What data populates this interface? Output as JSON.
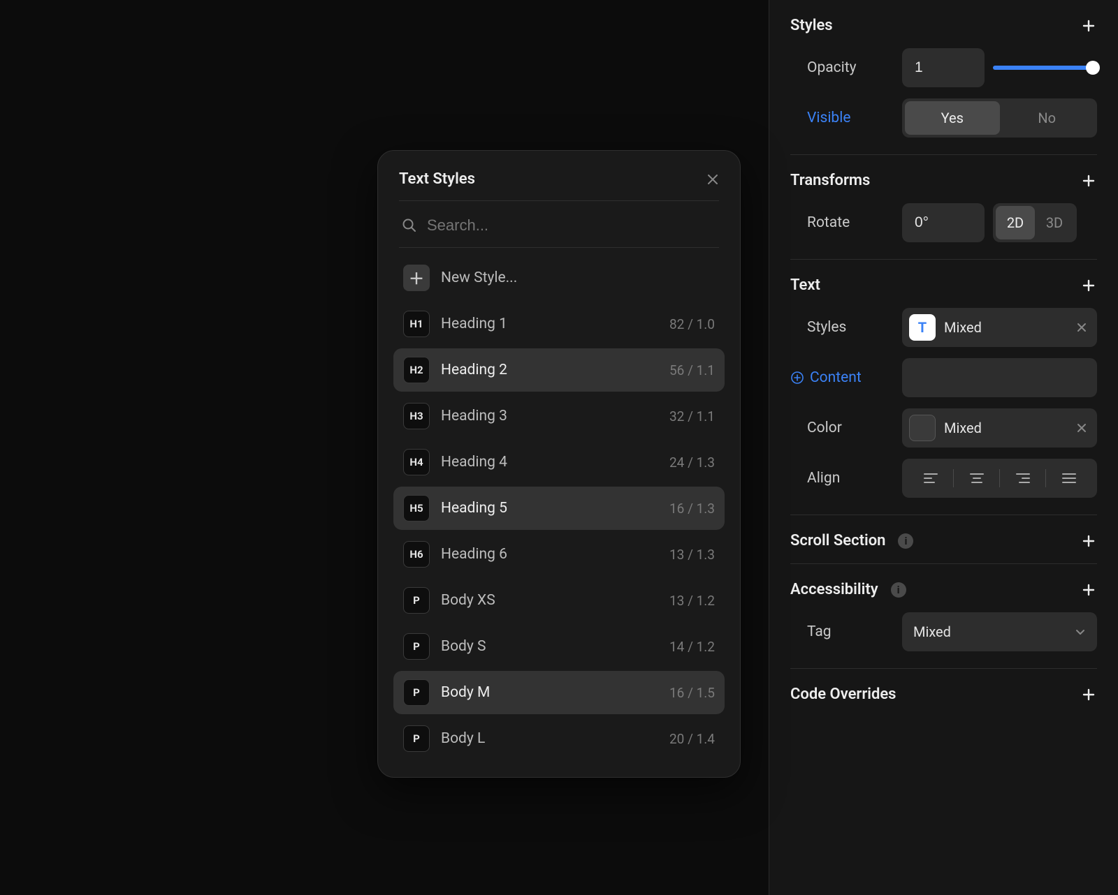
{
  "sidebar": {
    "styles": {
      "title": "Styles",
      "opacity_label": "Opacity",
      "opacity_value": "1",
      "visible_label": "Visible",
      "visible_yes": "Yes",
      "visible_no": "No"
    },
    "transforms": {
      "title": "Transforms",
      "rotate_label": "Rotate",
      "rotate_value": "0°",
      "mode_2d": "2D",
      "mode_3d": "3D"
    },
    "text": {
      "title": "Text",
      "styles_label": "Styles",
      "styles_value": "Mixed",
      "content_label": "Content",
      "color_label": "Color",
      "color_value": "Mixed",
      "align_label": "Align"
    },
    "scroll": {
      "title": "Scroll Section"
    },
    "accessibility": {
      "title": "Accessibility",
      "tag_label": "Tag",
      "tag_value": "Mixed"
    },
    "code": {
      "title": "Code Overrides"
    }
  },
  "popover": {
    "title": "Text Styles",
    "search_placeholder": "Search...",
    "new_style": "New Style...",
    "items": [
      {
        "badge": "H1",
        "name": "Heading 1",
        "meta": "82 / 1.0",
        "hl": false
      },
      {
        "badge": "H2",
        "name": "Heading 2",
        "meta": "56 / 1.1",
        "hl": true
      },
      {
        "badge": "H3",
        "name": "Heading 3",
        "meta": "32 / 1.1",
        "hl": false
      },
      {
        "badge": "H4",
        "name": "Heading 4",
        "meta": "24 / 1.3",
        "hl": false
      },
      {
        "badge": "H5",
        "name": "Heading 5",
        "meta": "16 / 1.3",
        "hl": true
      },
      {
        "badge": "H6",
        "name": "Heading 6",
        "meta": "13 / 1.3",
        "hl": false
      },
      {
        "badge": "P",
        "name": "Body XS",
        "meta": "13 / 1.2",
        "hl": false
      },
      {
        "badge": "P",
        "name": "Body S",
        "meta": "14 / 1.2",
        "hl": false
      },
      {
        "badge": "P",
        "name": "Body M",
        "meta": "16 / 1.5",
        "hl": true
      },
      {
        "badge": "P",
        "name": "Body L",
        "meta": "20 / 1.4",
        "hl": false
      }
    ]
  }
}
